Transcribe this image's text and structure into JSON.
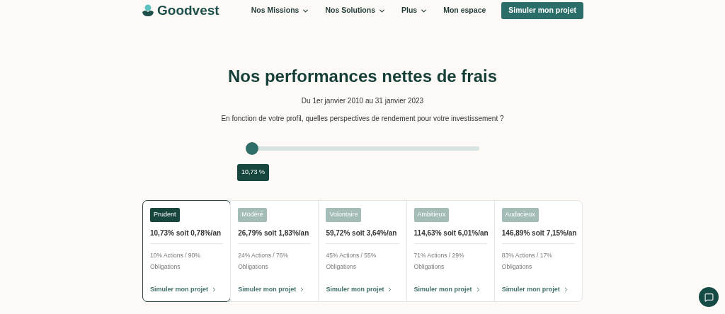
{
  "header": {
    "logo": "Goodvest",
    "nav": [
      {
        "label": "Nos Missions",
        "dropdown": true
      },
      {
        "label": "Nos Solutions",
        "dropdown": true
      },
      {
        "label": "Plus",
        "dropdown": true
      },
      {
        "label": "Mon espace",
        "dropdown": false
      }
    ],
    "cta": "Simuler mon projet"
  },
  "title": "Nos performances nettes de frais",
  "period": "Du 1er janvier 2010 au 31 janvier 2023",
  "question": "En fonction de votre profil, quelles perspectives de rendement pour votre investissement ?",
  "slider": {
    "level": 0.0,
    "reading": "10,73 %"
  },
  "profiles": [
    {
      "label": "Prudent",
      "selected": true,
      "performance": "10,73% soit 0,78%/an",
      "allocation": "10% Actions / 90% Obligations",
      "link": "Simuler mon projet"
    },
    {
      "label": "Modéré",
      "selected": false,
      "performance": "26,79%  soit 1,83%/an",
      "allocation": "24% Actions / 76% Obligations",
      "link": "Simuler mon projet"
    },
    {
      "label": "Volontaire",
      "selected": false,
      "performance": "59,72% soit 3,64%/an",
      "allocation": "45% Actions / 55% Obligations",
      "link": "Simuler mon projet"
    },
    {
      "label": "Ambitieux",
      "selected": false,
      "performance": "114,63% soit 6,01%/an",
      "allocation": "71% Actions / 29% Obligations",
      "link": "Simuler mon projet"
    },
    {
      "label": "Audacieux",
      "selected": false,
      "performance": "146,89%  soit 7,15%/an",
      "allocation": "83% Actions / 17% Obligations",
      "link": "Simuler mon projet"
    }
  ]
}
